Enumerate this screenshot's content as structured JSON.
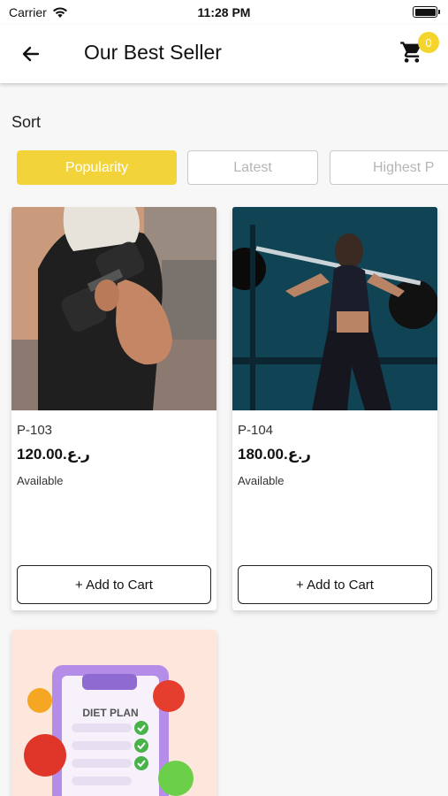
{
  "status_bar": {
    "carrier": "Carrier",
    "time": "11:28 PM"
  },
  "header": {
    "title": "Our Best Seller",
    "cart_count": "0"
  },
  "sort": {
    "label": "Sort",
    "options": [
      "Popularity",
      "Latest",
      "Highest P"
    ],
    "active_index": 0
  },
  "products": [
    {
      "sku": "P-103",
      "price": "120.00.ر.ع",
      "availability": "Available",
      "add_label": "+ Add to Cart",
      "image": "man-lifting-dumbbell-photo"
    },
    {
      "sku": "P-104",
      "price": "180.00.ر.ع",
      "availability": "Available",
      "add_label": "+ Add to Cart",
      "image": "woman-squatting-barbell-photo"
    },
    {
      "image": "diet-plan-illustration",
      "image_text": "DIET PLAN"
    }
  ],
  "colors": {
    "accent": "#F2D43A",
    "badge": "#F5D42C",
    "background": "#F7F7F7"
  }
}
